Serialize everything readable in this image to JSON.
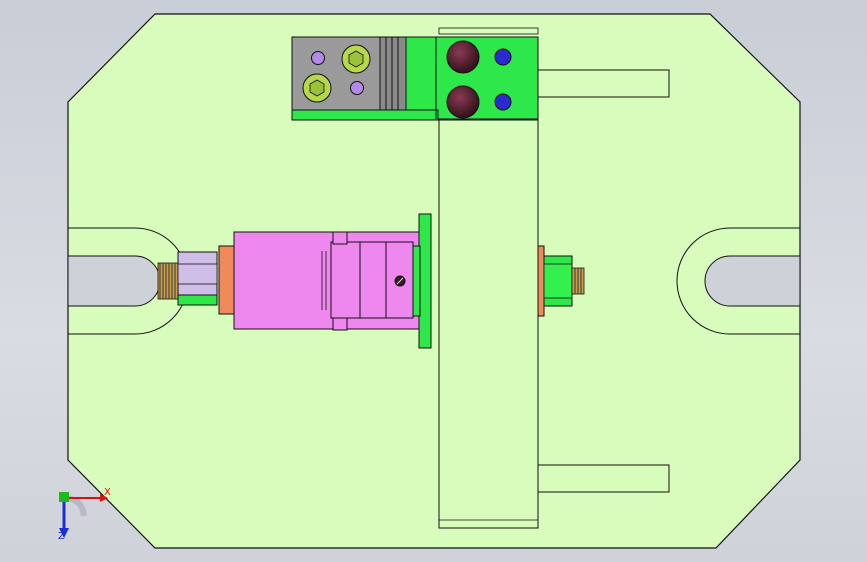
{
  "viewport": {
    "background_color": "#cdd1d8",
    "triad": {
      "x_label": "X",
      "z_label": "Z"
    }
  },
  "colors": {
    "base_plate": "#d8fcbc",
    "outline": "#111111",
    "green_part": "#2ee84a",
    "magenta_part": "#ee88ee",
    "orange_washer": "#f08a5a",
    "gray_block": "#9a9a9a",
    "dark_bolt": "#3a1a22",
    "blue_pin": "#2a2ad0",
    "violet_pin": "#b48ae8",
    "olive_bolt": "#b6d84a",
    "lavender_nut": "#cfbfe8",
    "axis_x": "#dd1111",
    "axis_y": "#1bbb1b",
    "axis_z": "#1b2fd9"
  }
}
